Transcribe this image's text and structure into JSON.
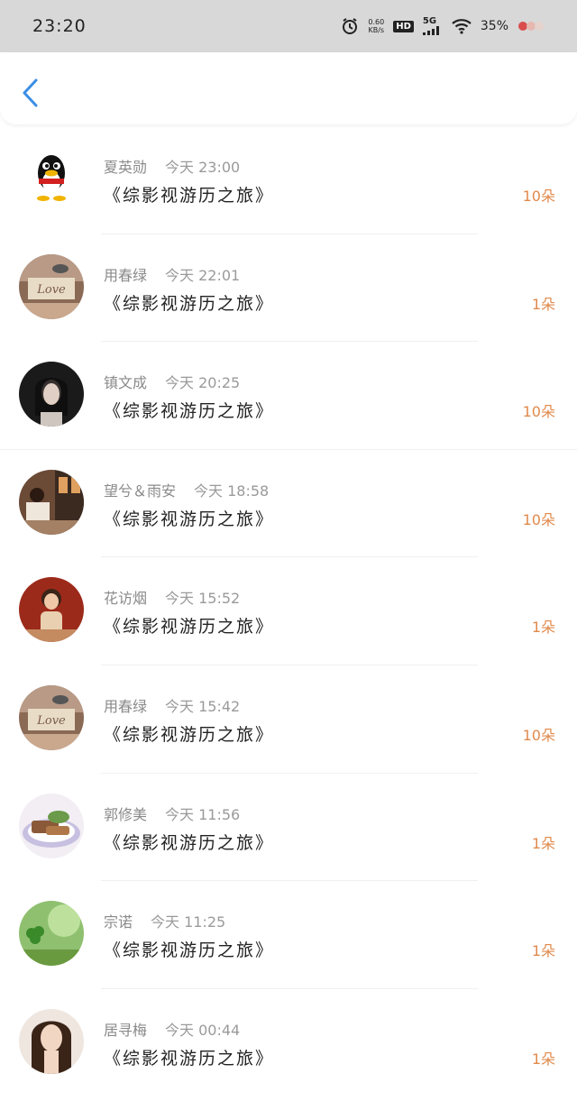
{
  "status": {
    "time": "23:20",
    "net_speed_value": "0.60",
    "net_speed_unit": "KB/s",
    "hd": "HD",
    "signal": "5G",
    "battery": "35%"
  },
  "colors": {
    "accent_blue": "#3a8ee6",
    "count_orange": "#e08a4c"
  },
  "items": [
    {
      "name": "夏英勋",
      "time": "今天 23:00",
      "book": "《综影视游历之旅》",
      "count": "10朵",
      "avatar": "qq-penguin"
    },
    {
      "name": "用春绿",
      "time": "今天 22:01",
      "book": "《综影视游历之旅》",
      "count": "1朵",
      "avatar": "love-bird"
    },
    {
      "name": "镇文成",
      "time": "今天 20:25",
      "book": "《综影视游历之旅》",
      "count": "10朵",
      "avatar": "girl-portrait"
    },
    {
      "name": "望兮＆雨安",
      "time": "今天 18:58",
      "book": "《综影视游历之旅》",
      "count": "10朵",
      "avatar": "cafe-scene"
    },
    {
      "name": "花访烟",
      "time": "今天 15:52",
      "book": "《综影视游历之旅》",
      "count": "1朵",
      "avatar": "child-photo"
    },
    {
      "name": "用春绿",
      "time": "今天 15:42",
      "book": "《综影视游历之旅》",
      "count": "10朵",
      "avatar": "love-bird"
    },
    {
      "name": "郭修美",
      "time": "今天 11:56",
      "book": "《综影视游历之旅》",
      "count": "1朵",
      "avatar": "food-plate"
    },
    {
      "name": "宗诺",
      "time": "今天 11:25",
      "book": "《综影视游历之旅》",
      "count": "1朵",
      "avatar": "green-clover"
    },
    {
      "name": "居寻梅",
      "time": "今天 00:44",
      "book": "《综影视游历之旅》",
      "count": "1朵",
      "avatar": "woman-portrait"
    }
  ]
}
